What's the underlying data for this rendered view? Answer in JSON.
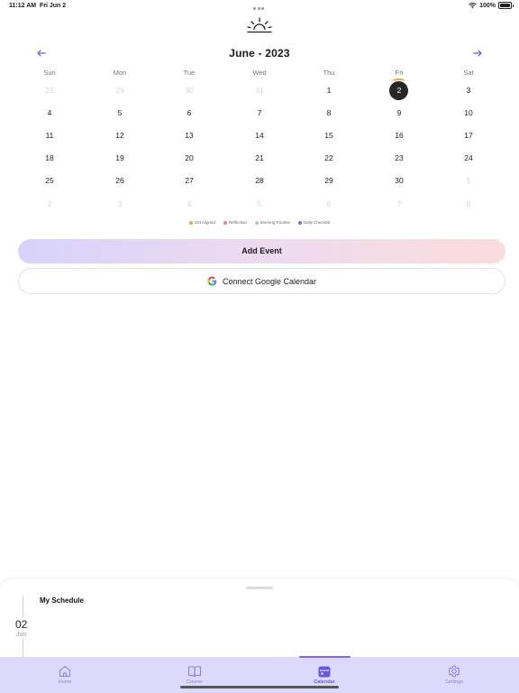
{
  "status_bar": {
    "time": "11:12 AM",
    "date": "Fri Jun 2",
    "battery": "100%"
  },
  "calendar": {
    "month_title": "June - 2023",
    "weekdays": [
      "Sun",
      "Mon",
      "Tue",
      "Wed",
      "Thu",
      "Fri",
      "Sat"
    ],
    "weeks": [
      [
        {
          "d": "28",
          "muted": true
        },
        {
          "d": "29",
          "muted": true
        },
        {
          "d": "30",
          "muted": true
        },
        {
          "d": "31",
          "muted": true
        },
        {
          "d": "1"
        },
        {
          "d": "2",
          "selected": true
        },
        {
          "d": "3"
        }
      ],
      [
        {
          "d": "4"
        },
        {
          "d": "5"
        },
        {
          "d": "6"
        },
        {
          "d": "7"
        },
        {
          "d": "8"
        },
        {
          "d": "9"
        },
        {
          "d": "10"
        }
      ],
      [
        {
          "d": "11"
        },
        {
          "d": "12"
        },
        {
          "d": "13"
        },
        {
          "d": "14"
        },
        {
          "d": "15"
        },
        {
          "d": "16"
        },
        {
          "d": "17"
        }
      ],
      [
        {
          "d": "18"
        },
        {
          "d": "19"
        },
        {
          "d": "20"
        },
        {
          "d": "21"
        },
        {
          "d": "22"
        },
        {
          "d": "23"
        },
        {
          "d": "24"
        }
      ],
      [
        {
          "d": "25"
        },
        {
          "d": "26"
        },
        {
          "d": "27"
        },
        {
          "d": "28"
        },
        {
          "d": "29"
        },
        {
          "d": "30"
        },
        {
          "d": "1",
          "muted": true
        }
      ],
      [
        {
          "d": "2",
          "muted": true
        },
        {
          "d": "3",
          "muted": true
        },
        {
          "d": "4",
          "muted": true
        },
        {
          "d": "5",
          "muted": true
        },
        {
          "d": "6",
          "muted": true
        },
        {
          "d": "7",
          "muted": true
        },
        {
          "d": "8",
          "muted": true
        }
      ]
    ],
    "legend": [
      {
        "label": "Get Aligned",
        "color": "#f2a648"
      },
      {
        "label": "Reflection",
        "color": "#f4836b"
      },
      {
        "label": "Morning Routine",
        "color": "#8fd0ef"
      },
      {
        "label": "Daily Checklist",
        "color": "#7b68e4"
      }
    ]
  },
  "actions": {
    "add_event": "Add Event",
    "connect_google": "Connect Google Calendar"
  },
  "schedule": {
    "title": "My Schedule",
    "date_day": "02",
    "date_month": "Jun"
  },
  "tabs": [
    {
      "label": "Home",
      "icon": "home-icon",
      "active": false
    },
    {
      "label": "Course",
      "icon": "book-icon",
      "active": false
    },
    {
      "label": "Calendar",
      "icon": "calendar-icon",
      "active": true
    },
    {
      "label": "Settings",
      "icon": "gear-icon",
      "active": false
    }
  ],
  "colors": {
    "accent": "#7c68e3",
    "selected_day": "#262626",
    "tab_bar": "#ddd9fd"
  }
}
